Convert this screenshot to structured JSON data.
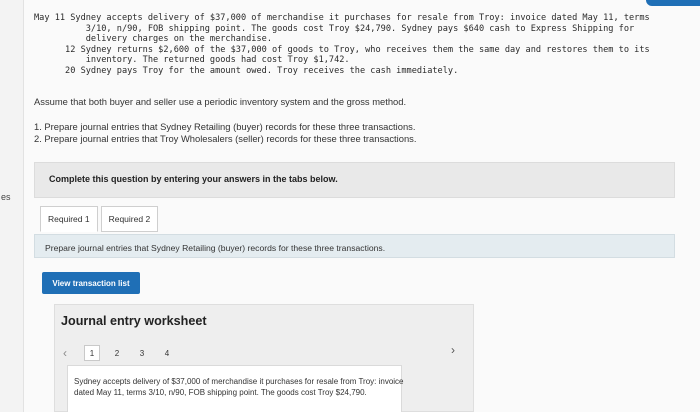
{
  "sidebar": {
    "edge_text": "es"
  },
  "problem": {
    "lines": [
      "May 11 Sydney accepts delivery of $37,000 of merchandise it purchases for resale from Troy: invoice dated May 11, terms",
      "          3/10, n/90, FOB shipping point. The goods cost Troy $24,790. Sydney pays $640 cash to Express Shipping for",
      "          delivery charges on the merchandise.",
      "      12 Sydney returns $2,600 of the $37,000 of goods to Troy, who receives them the same day and restores them to its",
      "          inventory. The returned goods had cost Troy $1,742.",
      "      20 Sydney pays Troy for the amount owed. Troy receives the cash immediately."
    ]
  },
  "assumption": "Assume that both buyer and seller use a periodic inventory system and the gross method.",
  "requirements": [
    "1. Prepare journal entries that Sydney Retailing (buyer) records for these three transactions.",
    "2. Prepare journal entries that Troy Wholesalers (seller) records for these three transactions."
  ],
  "instruction": "Complete this question by entering your answers in the tabs below.",
  "tabs": [
    {
      "label": "Required 1"
    },
    {
      "label": "Required 2"
    }
  ],
  "tab_prompt": "Prepare journal entries that Sydney Retailing (buyer) records for these three transactions.",
  "view_button": "View transaction list",
  "worksheet": {
    "title": "Journal entry worksheet",
    "pages": [
      "1",
      "2",
      "3",
      "4"
    ],
    "prev_icon": "chevron-left-icon",
    "next_icon": "chevron-right-icon",
    "description": "Sydney accepts delivery of $37,000 of merchandise it purchases for resale from Troy: invoice dated May 11, terms 3/10, n/90, FOB shipping point. The goods cost Troy $24,790."
  },
  "colors": {
    "accent": "#1f6fb6",
    "prompt_bg": "#e4ecf0",
    "panel_bg": "#eeeeee"
  }
}
